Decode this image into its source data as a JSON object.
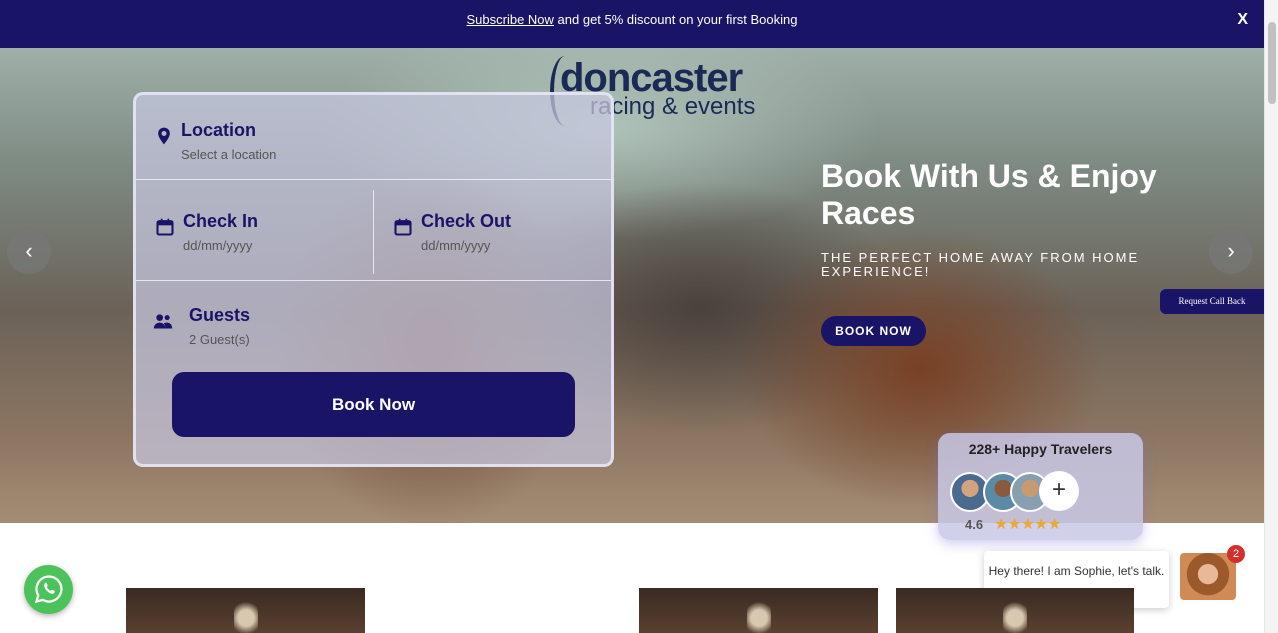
{
  "banner": {
    "link_text": "Subscribe Now",
    "message": " and get 5% discount on your first Booking",
    "close_label": "X"
  },
  "logo": {
    "line1": "doncaster",
    "line2": "racing & events"
  },
  "form": {
    "location": {
      "label": "Location",
      "value": "Select a location"
    },
    "check_in": {
      "label": "Check In",
      "placeholder": "dd/mm/yyyy"
    },
    "check_out": {
      "label": "Check Out",
      "placeholder": "dd/mm/yyyy"
    },
    "guests": {
      "label": "Guests",
      "value": "2 Guest(s)"
    },
    "submit": "Book Now"
  },
  "hero": {
    "title": "Book With Us & Enjoy Races",
    "subtitle": "THE PERFECT HOME AWAY FROM HOME EXPERIENCE!",
    "cta": "BOOK NOW",
    "prev_icon": "‹",
    "next_icon": "›"
  },
  "callback": {
    "label": "Request Call Back"
  },
  "travelers": {
    "title": "228+ Happy Travelers",
    "rating": "4.6",
    "stars": "★★★★★",
    "add_icon": "+"
  },
  "chat": {
    "message": "Hey there! I am Sophie, let's talk.",
    "badge": "2"
  },
  "colors": {
    "brand": "#1a1466",
    "whatsapp": "#4cc35a",
    "star": "#e8a93a",
    "badge": "#d32f2f"
  }
}
